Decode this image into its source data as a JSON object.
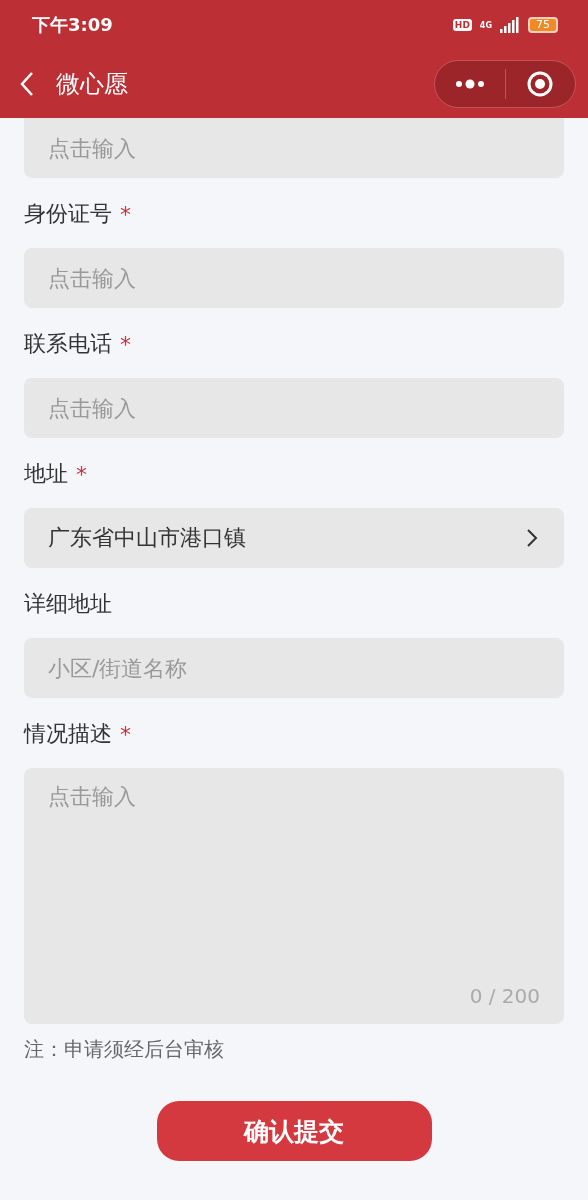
{
  "status_bar": {
    "time": "下午3:09",
    "hd_badge": "HD",
    "network": "4G",
    "battery": "75"
  },
  "nav": {
    "title": "微心愿"
  },
  "fields": [
    {
      "kind": "input",
      "placeholder": "点击输入"
    },
    {
      "kind": "input",
      "label": "身份证号",
      "required_mark": "*",
      "placeholder": "点击输入"
    },
    {
      "kind": "input",
      "label": "联系电话",
      "required_mark": "*",
      "placeholder": "点击输入"
    },
    {
      "kind": "select",
      "label": "地址",
      "required_mark": "*",
      "value": "广东省中山市港口镇"
    },
    {
      "kind": "input",
      "label": "详细地址",
      "placeholder": "小区/街道名称"
    },
    {
      "kind": "textarea",
      "label": "情况描述",
      "required_mark": "*",
      "placeholder": "点击输入",
      "counter": "0 / 200"
    }
  ],
  "note": "注：申请须经后台审核",
  "submit_button": "确认提交"
}
